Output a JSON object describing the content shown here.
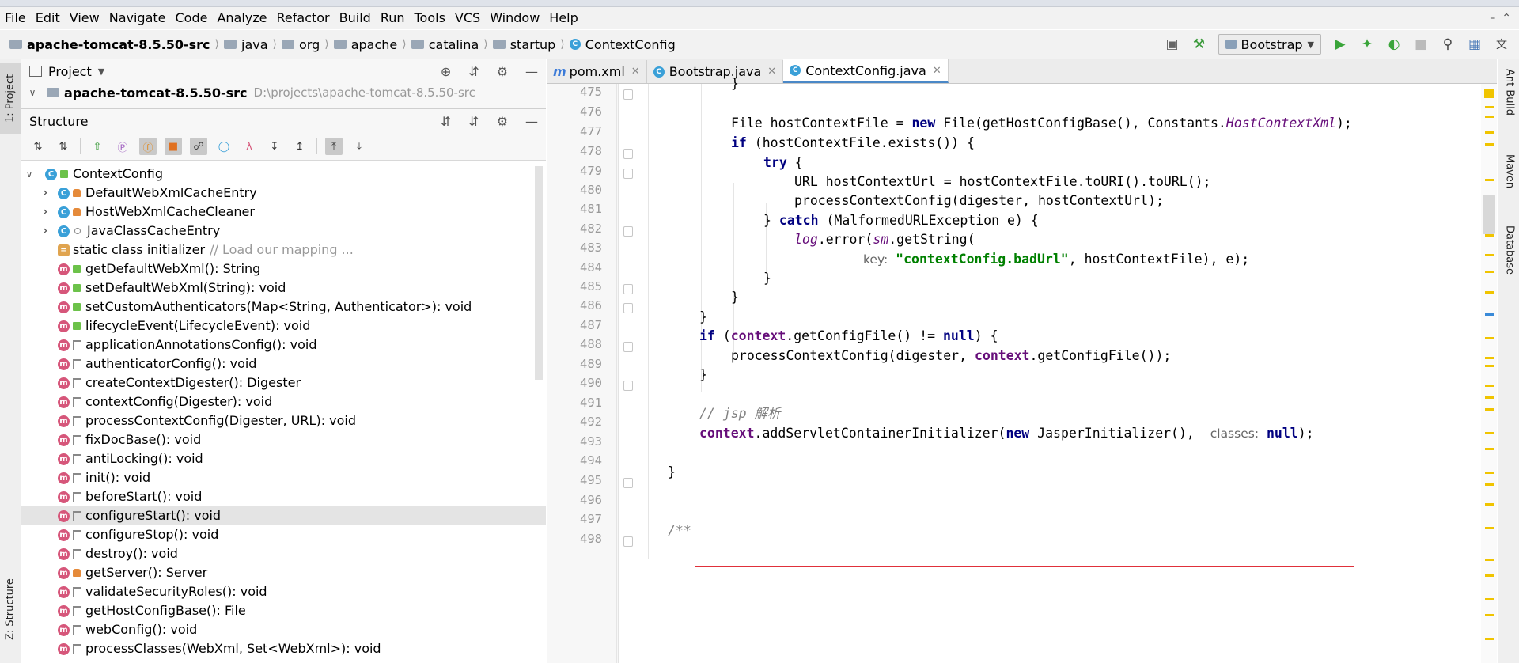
{
  "menu": [
    "File",
    "Edit",
    "View",
    "Navigate",
    "Code",
    "Analyze",
    "Refactor",
    "Build",
    "Run",
    "Tools",
    "VCS",
    "Window",
    "Help"
  ],
  "breadcrumb": [
    "apache-tomcat-8.5.50-src",
    "java",
    "org",
    "apache",
    "catalina",
    "startup",
    "ContextConfig"
  ],
  "run_config": "Bootstrap",
  "left_tabs": {
    "project": "1: Project",
    "structure": "Z: Structure"
  },
  "right_tabs": [
    "Ant Build",
    "Maven",
    "Database"
  ],
  "project_panel": {
    "title": "Project",
    "root_name": "apache-tomcat-8.5.50-src",
    "root_path": "D:\\projects\\apache-tomcat-8.5.50-src"
  },
  "structure_panel": {
    "title": "Structure",
    "root": "ContextConfig",
    "items": [
      {
        "icon": "class",
        "vis": "private",
        "label": "DefaultWebXmlCacheEntry",
        "expandable": true
      },
      {
        "icon": "class",
        "vis": "private",
        "label": "HostWebXmlCacheCleaner",
        "expandable": true
      },
      {
        "icon": "class",
        "vis": "pkg",
        "label": "JavaClassCacheEntry",
        "expandable": true
      },
      {
        "icon": "init",
        "vis": "none",
        "label": "static class initializer",
        "comment": "// Load our mapping ..."
      },
      {
        "icon": "method",
        "vis": "public",
        "label": "getDefaultWebXml(): String"
      },
      {
        "icon": "method",
        "vis": "public",
        "label": "setDefaultWebXml(String): void"
      },
      {
        "icon": "method",
        "vis": "public",
        "label": "setCustomAuthenticators(Map<String, Authenticator>): void"
      },
      {
        "icon": "method",
        "vis": "public",
        "label": "lifecycleEvent(LifecycleEvent): void"
      },
      {
        "icon": "method",
        "vis": "prot",
        "label": "applicationAnnotationsConfig(): void"
      },
      {
        "icon": "method",
        "vis": "prot",
        "label": "authenticatorConfig(): void"
      },
      {
        "icon": "method",
        "vis": "prot",
        "label": "createContextDigester(): Digester"
      },
      {
        "icon": "method",
        "vis": "prot",
        "label": "contextConfig(Digester): void"
      },
      {
        "icon": "method",
        "vis": "prot",
        "label": "processContextConfig(Digester, URL): void"
      },
      {
        "icon": "method",
        "vis": "prot",
        "label": "fixDocBase(): void"
      },
      {
        "icon": "method",
        "vis": "prot",
        "label": "antiLocking(): void"
      },
      {
        "icon": "method",
        "vis": "prot",
        "label": "init(): void"
      },
      {
        "icon": "method",
        "vis": "prot",
        "label": "beforeStart(): void"
      },
      {
        "icon": "method",
        "vis": "prot",
        "label": "configureStart(): void",
        "selected": true
      },
      {
        "icon": "method",
        "vis": "prot",
        "label": "configureStop(): void"
      },
      {
        "icon": "method",
        "vis": "prot",
        "label": "destroy(): void"
      },
      {
        "icon": "method",
        "vis": "private",
        "label": "getServer(): Server"
      },
      {
        "icon": "method",
        "vis": "prot",
        "label": "validateSecurityRoles(): void"
      },
      {
        "icon": "method",
        "vis": "prot",
        "label": "getHostConfigBase(): File"
      },
      {
        "icon": "method",
        "vis": "prot",
        "label": "webConfig(): void"
      },
      {
        "icon": "method",
        "vis": "prot",
        "label": "processClasses(WebXml, Set<WebXml>): void"
      }
    ]
  },
  "tabs": [
    {
      "label": "pom.xml",
      "icon": "m"
    },
    {
      "label": "Bootstrap.java",
      "icon": "c"
    },
    {
      "label": "ContextConfig.java",
      "icon": "c",
      "active": true
    }
  ],
  "line_numbers": [
    "475",
    "476",
    "477",
    "478",
    "479",
    "480",
    "481",
    "482",
    "483",
    "484",
    "485",
    "486",
    "487",
    "488",
    "489",
    "490",
    "491",
    "492",
    "493",
    "494",
    "495",
    "496",
    "497",
    "498"
  ],
  "code": {
    "l475": "}",
    "l477_a": "File hostContextFile = ",
    "l477_new": "new",
    "l477_b": " File(getHostConfigBase(), Constants.",
    "l477_fld": "HostContextXml",
    "l477_c": ");",
    "l478_kw": "if",
    "l478_b": " (hostContextFile.exists()) {",
    "l479_kw": "try",
    "l479_b": " {",
    "l480": "URL hostContextUrl = hostContextFile.toURI().toURL();",
    "l481": "processContextConfig(digester, hostContextUrl);",
    "l482_a": "} ",
    "l482_kw": "catch",
    "l482_b": " (MalformedURLException e) {",
    "l483_log": "log",
    "l483_a": ".error(",
    "l483_sm": "sm",
    "l483_b": ".getString(",
    "l484_hint": "key:",
    "l484_str": "\"contextConfig.badUrl\"",
    "l484_b": ", hostContextFile), e);",
    "l485": "}",
    "l486": "}",
    "l487": "}",
    "l488_kw": "if",
    "l488_a": " (",
    "l488_ctx": "context",
    "l488_b": ".getConfigFile() != ",
    "l488_null": "null",
    "l488_c": ") {",
    "l489_a": "processContextConfig(digester, ",
    "l489_ctx": "context",
    "l489_b": ".getConfigFile());",
    "l490": "}",
    "l492_cmt": "// jsp 解析",
    "l493_ctx": "context",
    "l493_a": ".addServletContainerInitializer(",
    "l493_new": "new",
    "l493_b": " JasperInitializer(), ",
    "l493_hint": "classes:",
    "l493_null": "null",
    "l493_c": ");",
    "l495": "}",
    "l498_cmt": "/**"
  },
  "colors": {
    "highlight_box": "#e0303a",
    "keyword": "#000080",
    "field": "#660e7a",
    "string": "#008000",
    "comment": "#808080"
  }
}
